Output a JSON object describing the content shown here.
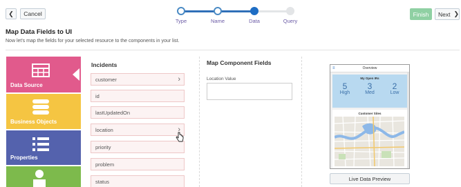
{
  "toolbar": {
    "back_icon": "chevron-left-icon",
    "cancel_label": "Cancel",
    "finish_label": "Finish",
    "next_label": "Next",
    "next_icon": "chevron-right-icon"
  },
  "train": {
    "steps": [
      {
        "label": "Type",
        "state": "done"
      },
      {
        "label": "Name",
        "state": "done"
      },
      {
        "label": "Data",
        "state": "active"
      },
      {
        "label": "Query",
        "state": "todo"
      }
    ]
  },
  "header": {
    "title": "Map Data Fields to UI",
    "description": "Now let's map the fields for your selected resource to the components in your list."
  },
  "tiles": [
    {
      "label": "Data Source",
      "icon": "table-icon",
      "color": "#e15a8c"
    },
    {
      "label": "Business Objects",
      "icon": "database-icon",
      "color": "#f5c542"
    },
    {
      "label": "Properties",
      "icon": "list-icon",
      "color": "#5462ad"
    },
    {
      "label": "",
      "icon": "person-icon",
      "color": "#7dba4c"
    }
  ],
  "incidents": {
    "title": "Incidents",
    "fields": [
      "customer",
      "id",
      "lastUpdatedOn",
      "location",
      "priority",
      "problem",
      "status"
    ]
  },
  "map": {
    "title": "Map Component Fields",
    "location_label": "Location Value",
    "location_value": ""
  },
  "preview": {
    "header": "Overview",
    "opens_title": "My Open IRs",
    "stats": [
      {
        "value": "5",
        "label": "High"
      },
      {
        "value": "3",
        "label": "Med"
      },
      {
        "value": "2",
        "label": "Low"
      }
    ],
    "sites_title": "Customer Sites",
    "live_label": "Live Data Preview"
  },
  "colors": {
    "accent": "#1f6dc4",
    "finish": "#8fd0a3",
    "train_label": "#6a5aa5"
  }
}
